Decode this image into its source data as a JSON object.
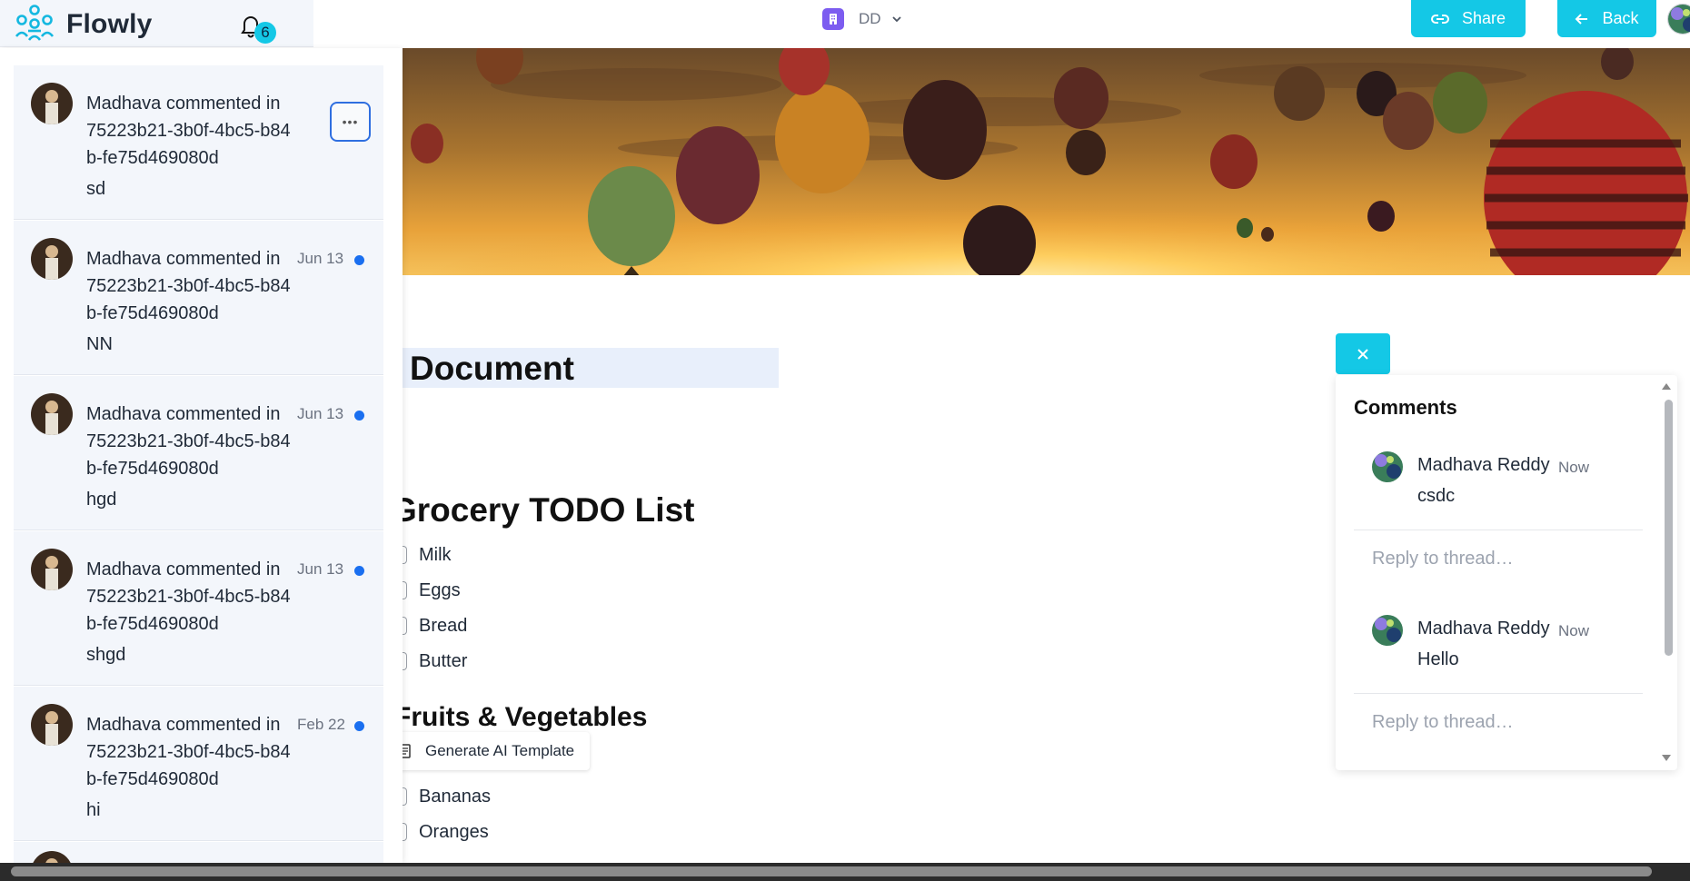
{
  "app": {
    "name": "Flowly",
    "notification_count": "6",
    "accent_color": "#14c8e6"
  },
  "workspace": {
    "name": "DD"
  },
  "actions": {
    "share_label": "Share",
    "back_label": "Back"
  },
  "notifications": [
    {
      "author_line": "Madhava commented in 75223b21-3b0f-4bc5-b84b-fe75d469080d",
      "message": "sd",
      "date": "",
      "unread": false
    },
    {
      "author_line": "Madhava commented in 75223b21-3b0f-4bc5-b84b-fe75d469080d",
      "message": "NN",
      "date": "Jun 13",
      "unread": true
    },
    {
      "author_line": "Madhava commented in 75223b21-3b0f-4bc5-b84b-fe75d469080d",
      "message": "hgd",
      "date": "Jun 13",
      "unread": true
    },
    {
      "author_line": "Madhava commented in 75223b21-3b0f-4bc5-b84b-fe75d469080d",
      "message": "shgd",
      "date": "Jun 13",
      "unread": true
    },
    {
      "author_line": "Madhava commented in 75223b21-3b0f-4bc5-b84b-fe75d469080d",
      "message": "hi",
      "date": "Feb 22",
      "unread": true
    }
  ],
  "document": {
    "title": "Document",
    "heading_grocery": "Grocery TODO List",
    "grocery_items": [
      "Milk",
      "Eggs",
      "Bread",
      "Butter"
    ],
    "heading_fruits": "Fruits & Vegetables",
    "generate_ai_label": "Generate AI Template",
    "fruit_items": [
      "Bananas",
      "Oranges"
    ]
  },
  "comments": {
    "title": "Comments",
    "threads": [
      {
        "author": "Madhava Reddy",
        "time": "Now",
        "text": "csdc",
        "reply_placeholder": "Reply to thread…"
      },
      {
        "author": "Madhava Reddy",
        "time": "Now",
        "text": "Hello",
        "reply_placeholder": "Reply to thread…"
      }
    ]
  }
}
